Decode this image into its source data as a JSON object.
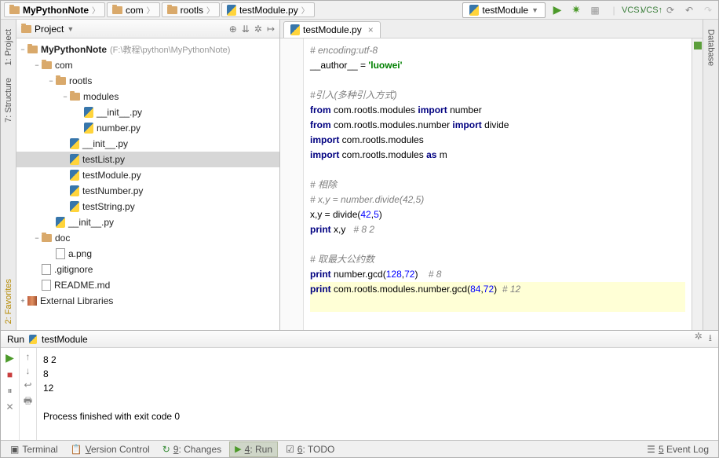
{
  "breadcrumbs": [
    {
      "name": "MyPythonNote",
      "icon": "folder",
      "bold": true
    },
    {
      "name": "com",
      "icon": "folder"
    },
    {
      "name": "rootls",
      "icon": "folder"
    },
    {
      "name": "testModule.py",
      "icon": "py"
    }
  ],
  "run_config": {
    "label": "testModule"
  },
  "project": {
    "header_label": "Project",
    "root": {
      "name": "MyPythonNote",
      "hint": "(F:\\教程\\python\\MyPythonNote)"
    },
    "tree": [
      {
        "depth": 1,
        "toggle": "−",
        "icon": "folder",
        "label": "com"
      },
      {
        "depth": 2,
        "toggle": "−",
        "icon": "folder",
        "label": "rootls"
      },
      {
        "depth": 3,
        "toggle": "−",
        "icon": "folder",
        "label": "modules"
      },
      {
        "depth": 4,
        "toggle": "",
        "icon": "py",
        "label": "__init__.py"
      },
      {
        "depth": 4,
        "toggle": "",
        "icon": "py",
        "label": "number.py"
      },
      {
        "depth": 3,
        "toggle": "",
        "icon": "py",
        "label": "__init__.py"
      },
      {
        "depth": 3,
        "toggle": "",
        "icon": "py",
        "label": "testList.py",
        "selected": true
      },
      {
        "depth": 3,
        "toggle": "",
        "icon": "py",
        "label": "testModule.py"
      },
      {
        "depth": 3,
        "toggle": "",
        "icon": "py",
        "label": "testNumber.py"
      },
      {
        "depth": 3,
        "toggle": "",
        "icon": "py",
        "label": "testString.py"
      },
      {
        "depth": 2,
        "toggle": "",
        "icon": "py",
        "label": "__init__.py"
      },
      {
        "depth": 1,
        "toggle": "−",
        "icon": "folder",
        "label": "doc"
      },
      {
        "depth": 2,
        "toggle": "",
        "icon": "md",
        "label": "a.png"
      },
      {
        "depth": 1,
        "toggle": "",
        "icon": "md",
        "label": ".gitignore"
      },
      {
        "depth": 1,
        "toggle": "",
        "icon": "md",
        "label": "README.md"
      }
    ],
    "external_libs": "External Libraries"
  },
  "editor": {
    "tab_name": "testModule.py",
    "lines": [
      {
        "html": "<span class='c-comment'># encoding:utf-8</span>"
      },
      {
        "html": "<span class='c-id'>__author__ = </span><span class='c-str'>'luowei'</span>"
      },
      {
        "html": ""
      },
      {
        "html": "<span class='c-comment'>#引入(多种引入方式)</span>"
      },
      {
        "html": "<span class='c-kw'>from</span> com.rootls.modules <span class='c-kw'>import</span> number"
      },
      {
        "html": "<span class='c-kw'>from</span> com.rootls.modules.number <span class='c-kw'>import</span> divide"
      },
      {
        "html": "<span class='c-kw'>import</span> com.rootls.modules"
      },
      {
        "html": "<span class='c-kw'>import</span> com.rootls.modules <span class='c-kw'>as</span> m"
      },
      {
        "html": ""
      },
      {
        "html": "<span class='c-comment'># 相除</span>"
      },
      {
        "html": "<span class='c-comment'># x,y = number.divide(42,5)</span>"
      },
      {
        "html": "x,y = divide(<span class='c-num'>42</span>,<span class='c-num'>5</span>)"
      },
      {
        "html": "<span class='c-kw'>print</span> x,y   <span class='c-comment'># 8 2</span>"
      },
      {
        "html": ""
      },
      {
        "html": "<span class='c-comment'># 取最大公约数</span>"
      },
      {
        "html": "<span class='c-kw'>print</span> number.gcd(<span class='c-num'>128</span>,<span class='c-num'>72</span>)    <span class='c-comment'># 8</span>"
      },
      {
        "html": "<span class='c-kw'>print</span> com.rootls.modules.number.gcd(<span class='c-num'>84</span>,<span class='c-num'>72</span>)  <span class='c-comment'># 12</span>",
        "highlight": true
      },
      {
        "html": "",
        "highlight": true
      }
    ]
  },
  "run": {
    "header_label": "Run",
    "module_name": "testModule",
    "output": [
      "8 2",
      "8",
      "12",
      "",
      "Process finished with exit code 0"
    ]
  },
  "left_tabs": {
    "project": "1: Project",
    "structure": "7: Structure",
    "favorites": "2: Favorites"
  },
  "right_tabs": {
    "database": "Database"
  },
  "status": {
    "terminal": "Terminal",
    "version_control": "Version Control",
    "changes": "9: Changes",
    "run": "4: Run",
    "todo": "6: TODO",
    "event_log": "5 Event Log"
  }
}
